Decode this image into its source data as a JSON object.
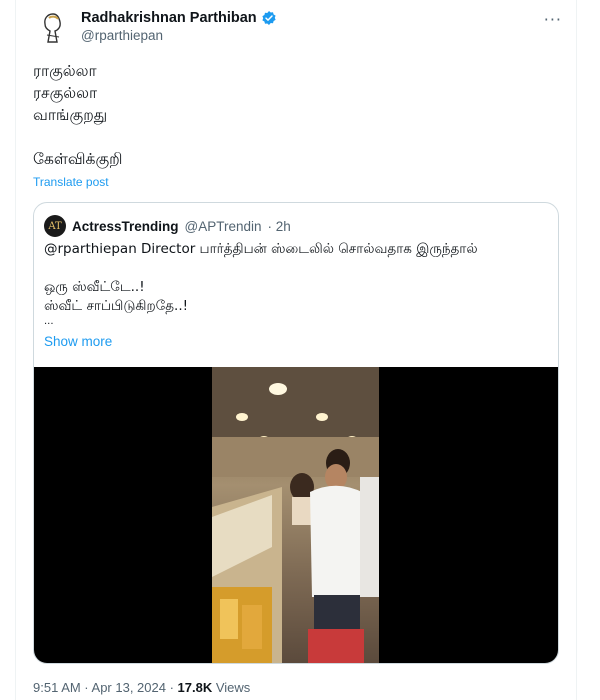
{
  "author": {
    "display_name": "Radhakrishnan Parthiban",
    "handle": "@rparthiepan",
    "verified": true,
    "verified_color": "#1d9bf0"
  },
  "more_glyph": "···",
  "tweet_lines": [
    "ராகுல்லா",
    "ரசகுல்லா",
    "வாங்குறது",
    "",
    "கேள்விக்குறி"
  ],
  "translate_label": "Translate post",
  "quote": {
    "avatar_letters": "AT",
    "display_name": "ActressTrending",
    "handle": "@APTrendin",
    "time": "· 2h",
    "lines": [
      "@rparthiepan Director பார்த்திபன் ஸ்டைலில் சொல்வதாக இருந்தால்",
      "",
      "ஒரு ஸ்வீட்டே..!",
      "ஸ்வீட் சாப்பிடுகிறதே..!",
      "..."
    ],
    "show_more": "Show more"
  },
  "footer": {
    "time": "9:51 AM · Apr 13, 2024 · ",
    "views_count": "17.8K",
    "views_label": " Views"
  },
  "colors": {
    "link": "#1d9bf0",
    "secondary_text": "#536471",
    "border": "#cfd9de"
  }
}
